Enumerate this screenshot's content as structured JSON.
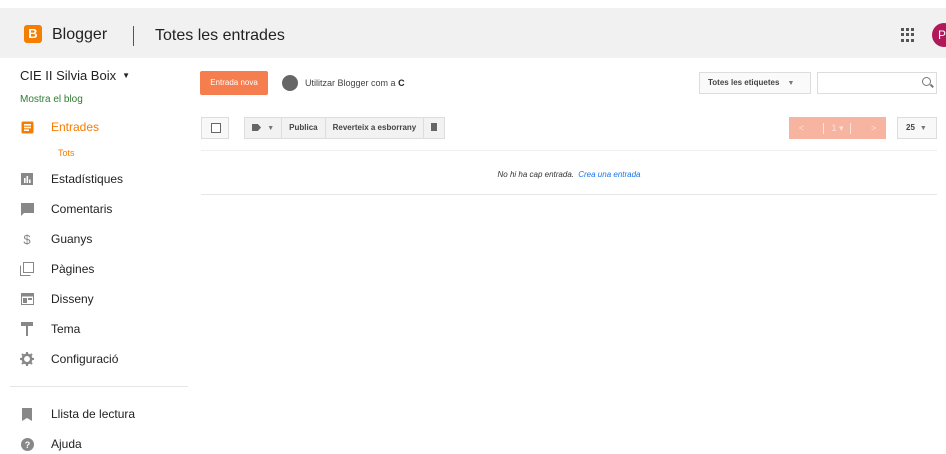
{
  "header": {
    "brand": "Blogger",
    "logo_letter": "B",
    "page_title": "Totes les entrades",
    "avatar_letter": "P"
  },
  "sidebar": {
    "blog_name": "CIE II Silvia Boix",
    "view_blog": "Mostra el blog",
    "items": [
      {
        "label": "Entrades",
        "icon": "posts-icon",
        "active": true
      },
      {
        "label": "Estadístiques",
        "icon": "stats-icon"
      },
      {
        "label": "Comentaris",
        "icon": "comments-icon"
      },
      {
        "label": "Guanys",
        "icon": "dollar-icon"
      },
      {
        "label": "Pàgines",
        "icon": "pages-icon"
      },
      {
        "label": "Disseny",
        "icon": "layout-icon"
      },
      {
        "label": "Tema",
        "icon": "theme-icon"
      },
      {
        "label": "Configuració",
        "icon": "gear-icon"
      },
      {
        "label": "Llista de lectura",
        "icon": "bookmark-icon"
      },
      {
        "label": "Ajuda",
        "icon": "help-icon"
      }
    ],
    "sub_item": "Tots"
  },
  "main": {
    "new_post": "Entrada nova",
    "use_as_prefix": "Utilitzar Blogger com a",
    "use_as_value": "C",
    "labels_filter": "Totes les etiquetes",
    "publish": "Publica",
    "revert": "Reverteix a esborrany",
    "per_page": "25",
    "pager_page": "1",
    "empty_text": "No hi ha cap entrada.",
    "create_link": "Crea una entrada"
  },
  "colors": {
    "accent": "#f57d00",
    "new_button": "#f57d4e",
    "pager_disabled": "#f7b4a1",
    "link": "#1a73e8"
  }
}
